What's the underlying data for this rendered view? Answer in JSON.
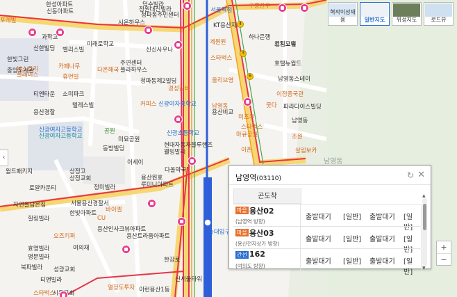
{
  "map": {
    "labels": [
      {
        "t": "덕수빌라",
        "c": "dark"
      },
      {
        "t": "정원대신빌라",
        "c": "dark"
      },
      {
        "t": "청파동주민센터",
        "c": "dark"
      },
      {
        "t": "서울역점",
        "c": "blue"
      },
      {
        "t": "구룡한우",
        "c": "orange"
      },
      {
        "t": "한성아파트",
        "c": "dark"
      },
      {
        "t": "신동아파트",
        "c": "dark"
      },
      {
        "t": "포레빌",
        "c": "orange"
      },
      {
        "t": "시온하우스",
        "c": "dark"
      },
      {
        "t": "KT용산지사",
        "c": "dark"
      },
      {
        "t": "하나은행",
        "c": "dark"
      },
      {
        "t": "천일고속",
        "c": "dark"
      },
      {
        "t": "과학고",
        "c": "dark"
      },
      {
        "t": "신한빌딩",
        "c": "dark"
      },
      {
        "t": "미래로학교",
        "c": "dark"
      },
      {
        "t": "코지오텔",
        "c": "dark"
      },
      {
        "t": "벨리스빌",
        "c": "dark"
      },
      {
        "t": "신신사우나",
        "c": "dark"
      },
      {
        "t": "계원원",
        "c": "orange"
      },
      {
        "t": "스타벅스",
        "c": "orange"
      },
      {
        "t": "한빛그린",
        "c": "dark"
      },
      {
        "t": "본스토리",
        "c": "orange"
      },
      {
        "t": "중앙도서관",
        "c": "dark"
      },
      {
        "t": "카페나무",
        "c": "orange"
      },
      {
        "t": "다온해국",
        "c": "orange"
      },
      {
        "t": "주연센터",
        "c": "dark"
      },
      {
        "t": "풀라하우스",
        "c": "dark"
      },
      {
        "t": "호텔뉴월드",
        "c": "dark"
      },
      {
        "t": "플레이스",
        "c": "orange"
      },
      {
        "t": "휴먼빌",
        "c": "orange"
      },
      {
        "t": "올리브영",
        "c": "orange"
      },
      {
        "t": "남영동스테이",
        "c": "dark"
      },
      {
        "t": "청파동제2빌딩",
        "c": "dark"
      },
      {
        "t": "경성갈비",
        "c": "orange"
      },
      {
        "t": "이정중국관",
        "c": "orange"
      },
      {
        "t": "티엔타운",
        "c": "dark"
      },
      {
        "t": "소미파크",
        "c": "dark"
      },
      {
        "t": "커피스",
        "c": "orange"
      },
      {
        "t": "신광여자중학교",
        "c": "blue"
      },
      {
        "t": "남영동",
        "c": "orange"
      },
      {
        "t": "뭇다",
        "c": "orange"
      },
      {
        "t": "용산경찰",
        "c": "dark"
      },
      {
        "t": "텔레스빌",
        "c": "dark"
      },
      {
        "t": "용산비교",
        "c": "dark"
      },
      {
        "t": "파라다이스빌딩",
        "c": "dark"
      },
      {
        "t": "신광여자고등학교",
        "c": "blue"
      },
      {
        "t": "신광여자고등학교",
        "c": "teal"
      },
      {
        "t": "스타벅스",
        "c": "orange"
      },
      {
        "t": "미즈쿠",
        "c": "orange"
      },
      {
        "t": "공원",
        "c": "green"
      },
      {
        "t": "미묘공원",
        "c": "dark"
      },
      {
        "t": "마큐공원",
        "c": "orange"
      },
      {
        "t": "남영동",
        "c": "dark"
      },
      {
        "t": "신광초등학교",
        "c": "blue"
      },
      {
        "t": "조원",
        "c": "orange"
      },
      {
        "t": "동방빌딩",
        "c": "dark"
      },
      {
        "t": "현대자동차블루핸즈",
        "c": "dark"
      },
      {
        "t": "웰빙발리",
        "c": "dark"
      },
      {
        "t": "이촌",
        "c": "orange"
      },
      {
        "t": "살림보카",
        "c": "orange"
      },
      {
        "t": "이세이",
        "c": "dark"
      },
      {
        "t": "다올약국",
        "c": "dark"
      },
      {
        "t": "남영동",
        "c": "district"
      },
      {
        "t": "상정고",
        "c": "dark"
      },
      {
        "t": "용산원효",
        "c": "dark"
      },
      {
        "t": "루미니아파트",
        "c": "dark"
      },
      {
        "t": "월드패키지",
        "c": "dark"
      },
      {
        "t": "상정교회",
        "c": "dark"
      },
      {
        "t": "로얄카운티",
        "c": "dark"
      },
      {
        "t": "정미빌라",
        "c": "dark"
      },
      {
        "t": "자연을담은집",
        "c": "dark"
      },
      {
        "t": "서울용산경찰서",
        "c": "dark"
      },
      {
        "t": "바이엘",
        "c": "orange"
      },
      {
        "t": "힐링빌라",
        "c": "dark"
      },
      {
        "t": "한빛아파트",
        "c": "dark"
      },
      {
        "t": "CU",
        "c": "orange"
      },
      {
        "t": "용산인사크뷰아파트",
        "c": "dark"
      },
      {
        "t": "오즈키퍼",
        "c": "orange"
      },
      {
        "t": "용산트라움아파트",
        "c": "dark"
      },
      {
        "t": "효명빌라",
        "c": "dark"
      },
      {
        "t": "여의재",
        "c": "dark"
      },
      {
        "t": "명문빌라",
        "c": "dark"
      },
      {
        "t": "한강로",
        "c": "dark"
      },
      {
        "t": "북파빌라",
        "c": "dark"
      },
      {
        "t": "성광교회",
        "c": "dark"
      },
      {
        "t": "티앤빌라",
        "c": "dark"
      },
      {
        "t": "열정도투자",
        "c": "orange"
      },
      {
        "t": "이런용산1동",
        "c": "dark"
      },
      {
        "t": "스타벅스",
        "c": "orange"
      },
      {
        "t": "시온교회",
        "c": "dark"
      },
      {
        "t": "숙대입구",
        "c": "blue"
      },
      {
        "t": "신서울타워",
        "c": "dark"
      }
    ]
  },
  "map_types": [
    {
      "label": "혁작이성재용",
      "active": false
    },
    {
      "label": "일반지도",
      "active": true
    },
    {
      "label": "위성지도",
      "active": false
    },
    {
      "label": "로드뷰",
      "active": false
    }
  ],
  "zoom": {
    "plus": "+",
    "minus": "−"
  },
  "left_toggle": "‹",
  "popup": {
    "station_name": "남영역",
    "station_code": "(03110)",
    "refresh_icon": "↻",
    "close_icon": "✕",
    "column_header": "곤도착",
    "rows": [
      {
        "badge": "마을",
        "badge_color": "#e8702a",
        "route": "용산02",
        "direction": "(남영역 방향)",
        "c1": "출발대기",
        "c2": "[일반]",
        "c3": "출발대기",
        "c4": "[일반]"
      },
      {
        "badge": "마을",
        "badge_color": "#e8702a",
        "route": "용산03",
        "direction": "(용산전자상가 방향)",
        "c1": "출발대기",
        "c2": "[일반]",
        "c3": "출발대기",
        "c4": "[일반]"
      },
      {
        "badge": "간선",
        "badge_color": "#2a6fd1",
        "route": "162",
        "direction": "(여의도 방향)",
        "c1": "출발대기",
        "c2": "[일반]",
        "c3": "출발대기",
        "c4": "[일반]"
      }
    ]
  },
  "colors": {
    "bus_route": "#e8344a",
    "subway": "#2e5fd8",
    "road_yellow": "#f4c430",
    "popup_border": "#999999"
  }
}
